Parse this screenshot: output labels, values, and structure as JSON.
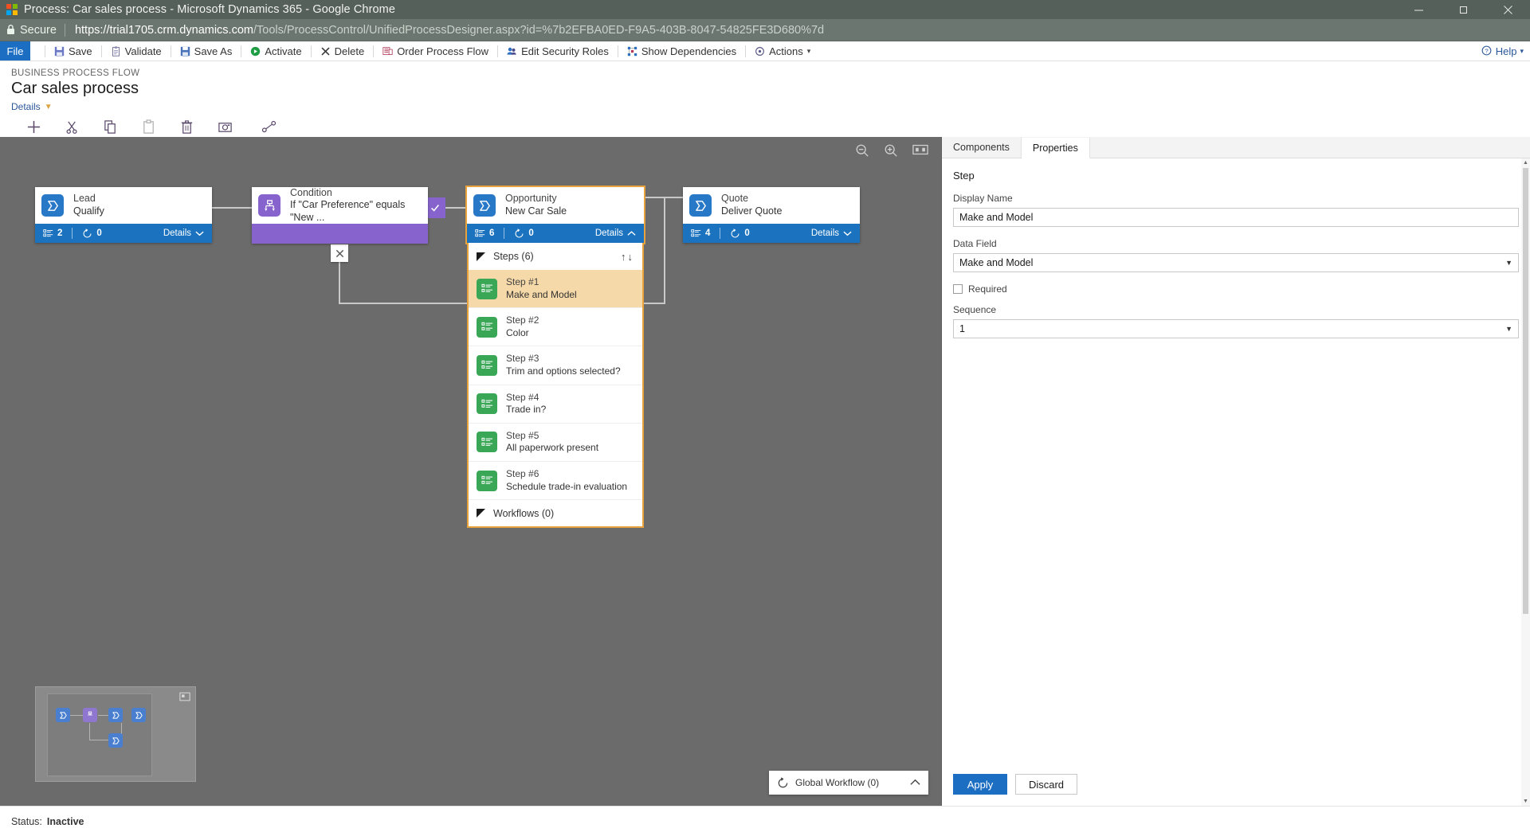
{
  "window": {
    "title": "Process: Car sales process - Microsoft Dynamics 365 - Google Chrome",
    "minimize": "minimize-icon",
    "maximize": "maximize-icon",
    "close": "close-icon"
  },
  "browser": {
    "secure_label": "Secure",
    "url_domain": "https://trial1705.crm.dynamics.com",
    "url_path": "/Tools/ProcessControl/UnifiedProcessDesigner.aspx?id=%7b2EFBA0ED-F9A5-403B-8047-54825FE3D680%7d"
  },
  "commandbar": {
    "file": "File",
    "items": [
      {
        "label": "Save",
        "icon": "save-icon"
      },
      {
        "label": "Validate",
        "icon": "validate-icon"
      },
      {
        "label": "Save As",
        "icon": "save-as-icon"
      },
      {
        "label": "Activate",
        "icon": "activate-icon"
      },
      {
        "label": "Delete",
        "icon": "delete-icon"
      },
      {
        "label": "Order Process Flow",
        "icon": "order-process-flow-icon"
      },
      {
        "label": "Edit Security Roles",
        "icon": "edit-security-roles-icon"
      },
      {
        "label": "Show Dependencies",
        "icon": "show-dependencies-icon"
      },
      {
        "label": "Actions",
        "icon": "actions-icon"
      }
    ],
    "help": "Help"
  },
  "header": {
    "eyebrow": "BUSINESS PROCESS FLOW",
    "title": "Car sales process",
    "details": "Details"
  },
  "toolbar": [
    {
      "label": "Add",
      "icon": "plus-icon",
      "disabled": false
    },
    {
      "label": "Cut",
      "icon": "scissors-icon",
      "disabled": false
    },
    {
      "label": "Copy",
      "icon": "copy-icon",
      "disabled": false
    },
    {
      "label": "Paste",
      "icon": "paste-icon",
      "disabled": true
    },
    {
      "label": "Delete",
      "icon": "trash-icon",
      "disabled": false
    },
    {
      "label": "Snapshot",
      "icon": "camera-icon",
      "disabled": false
    },
    {
      "label": "Connector",
      "icon": "connector-icon",
      "disabled": false
    }
  ],
  "canvas": {
    "tools": [
      {
        "name": "zoom-out-icon"
      },
      {
        "name": "zoom-in-icon"
      },
      {
        "name": "fit-to-screen-icon"
      }
    ],
    "stages": [
      {
        "id": "lead",
        "name": "Lead",
        "subtitle": "Qualify",
        "steps_count": "2",
        "workflows_count": "0",
        "details_label": "Details",
        "color": "blue",
        "selected": false
      },
      {
        "id": "condition",
        "name": "Condition",
        "subtitle": "If \"Car Preference\" equals \"New ...",
        "color": "purple",
        "selected": false
      },
      {
        "id": "opportunity",
        "name": "Opportunity",
        "subtitle": "New Car Sale",
        "steps_count": "6",
        "workflows_count": "0",
        "details_label": "Details",
        "color": "blue",
        "selected": true
      },
      {
        "id": "quote",
        "name": "Quote",
        "subtitle": "Deliver Quote",
        "steps_count": "4",
        "workflows_count": "0",
        "details_label": "Details",
        "color": "blue",
        "selected": false
      }
    ],
    "steps_panel": {
      "header": "Steps (6)",
      "move_up": "↑",
      "move_down": "↓",
      "items": [
        {
          "number": "Step #1",
          "description": "Make and Model",
          "active": true
        },
        {
          "number": "Step #2",
          "description": "Color",
          "active": false
        },
        {
          "number": "Step #3",
          "description": "Trim and options selected?",
          "active": false
        },
        {
          "number": "Step #4",
          "description": "Trade in?",
          "active": false
        },
        {
          "number": "Step #5",
          "description": "All paperwork present",
          "active": false
        },
        {
          "number": "Step #6",
          "description": "Schedule trade-in evaluation",
          "active": false
        }
      ],
      "workflows_header": "Workflows (0)"
    },
    "global_workflow": {
      "label": "Global Workflow (0)",
      "icon": "workflow-icon",
      "chevron": "chevron-up-icon"
    },
    "minimap": {
      "expand_icon": "expand-minimap-icon"
    }
  },
  "properties": {
    "tabs": [
      {
        "label": "Components",
        "active": false
      },
      {
        "label": "Properties",
        "active": true
      }
    ],
    "section_title": "Step",
    "display_name_label": "Display Name",
    "display_name_value": "Make and Model",
    "data_field_label": "Data Field",
    "data_field_value": "Make and Model",
    "required_label": "Required",
    "required_checked": false,
    "sequence_label": "Sequence",
    "sequence_value": "1",
    "apply": "Apply",
    "discard": "Discard"
  },
  "statusbar": {
    "label": "Status:",
    "value": "Inactive"
  },
  "colors": {
    "accent_blue": "#1b6ec2",
    "stage_blue": "#2878c8",
    "stage_purple": "#8764cd",
    "step_green": "#3aa757",
    "selected_amber": "#e8a33d",
    "selected_row": "#f5d9a8",
    "canvas_gray": "#6b6b6b"
  }
}
